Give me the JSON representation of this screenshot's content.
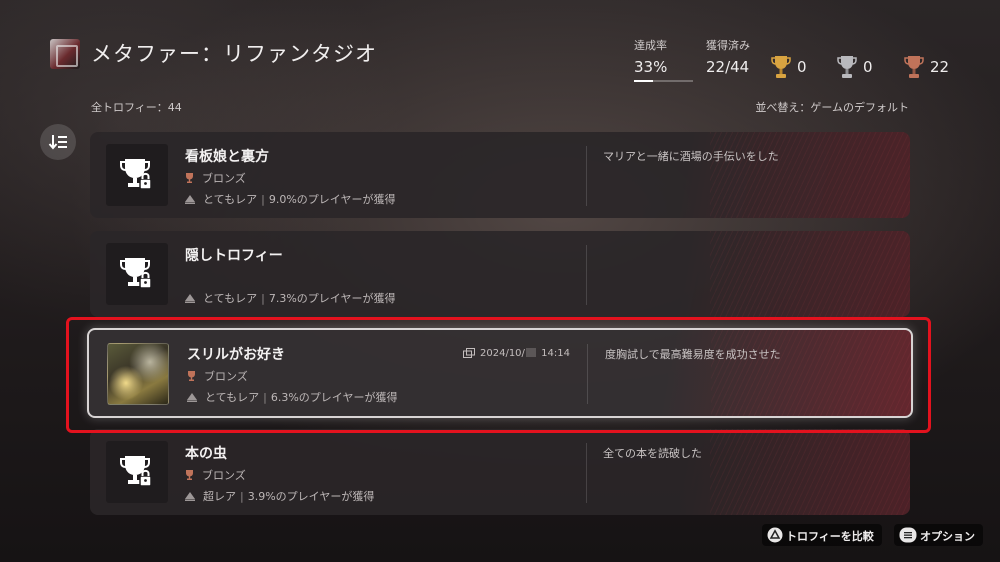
{
  "header": {
    "game_title": "メタファー：リファンタジオ",
    "completion_label": "達成率",
    "completion_value": "33%",
    "completion_fraction": 0.33,
    "earned_label": "獲得済み",
    "earned_value": "22/44",
    "gold_count": "0",
    "silver_count": "0",
    "bronze_count": "22",
    "total_label": "全トロフィー：44",
    "sort_label": "並べ替え：ゲームのデフォルト"
  },
  "trophies": [
    {
      "name": "看板娘と裏方",
      "grade": "ブロンズ",
      "rarity": "とてもレア",
      "percent": "9.0%のプレイヤーが獲得",
      "description": "マリアと一緒に酒場の手伝いをした",
      "locked": true
    },
    {
      "name": "隠しトロフィー",
      "grade": "",
      "rarity": "とてもレア",
      "percent": "7.3%のプレイヤーが獲得",
      "description": "",
      "locked": true
    },
    {
      "name": "スリルがお好き",
      "grade": "ブロンズ",
      "rarity": "とてもレア",
      "percent": "6.3%のプレイヤーが獲得",
      "description": "度胸試しで最高難易度を成功させた",
      "earned_date_prefix": "2024/10/",
      "earned_time": "14:14",
      "locked": false
    },
    {
      "name": "本の虫",
      "grade": "ブロンズ",
      "rarity": "超レア",
      "percent": "3.9%のプレイヤーが獲得",
      "description": "全ての本を読破した",
      "locked": true
    }
  ],
  "footer": {
    "compare_label": "トロフィーを比較",
    "options_label": "オプション"
  },
  "colors": {
    "gold": "#d9a441",
    "silver": "#b9b9bd",
    "bronze": "#c0735a",
    "highlight": "#e3121e"
  }
}
